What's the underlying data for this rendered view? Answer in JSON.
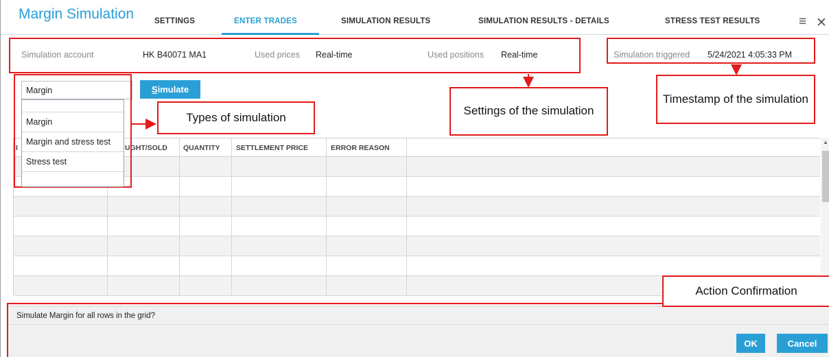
{
  "app": {
    "title": "Margin Simulation",
    "tabs": [
      "SETTINGS",
      "ENTER TRADES",
      "SIMULATION RESULTS",
      "SIMULATION RESULTS - DETAILS",
      "STRESS TEST RESULTS"
    ],
    "active_tab": "ENTER TRADES",
    "menu_icon": "hamburger-menu-icon",
    "close_icon": "close-icon"
  },
  "settings": {
    "account_label": "Simulation account",
    "account_value": "HK B40071 MA1",
    "prices_label": "Used prices",
    "prices_value": "Real-time",
    "positions_label": "Used positions",
    "positions_value": "Real-time",
    "triggered_label": "Simulation triggered",
    "triggered_value": "5/24/2021 4:05:33 PM"
  },
  "simulation": {
    "type_value": "Margin",
    "simulate_label_first": "S",
    "simulate_label_rest": "imulate",
    "options": [
      "Margin",
      "Margin and stress test",
      "Stress test"
    ]
  },
  "grid": {
    "columns": [
      "I",
      "UGHT/SOLD",
      "QUANTITY",
      "SETTLEMENT PRICE",
      "ERROR REASON"
    ],
    "row_count": 7
  },
  "confirmation": {
    "message": "Simulate Margin for all rows in the grid?",
    "ok_label": "OK",
    "cancel_label": "Cancel"
  },
  "annotations": {
    "types": "Types of simulation",
    "settings": "Settings of the simulation",
    "timestamp": "Timestamp of the simulation",
    "action": "Action Confirmation",
    "color": "#e41a1c"
  },
  "colors": {
    "accent": "#2a9fd6"
  }
}
